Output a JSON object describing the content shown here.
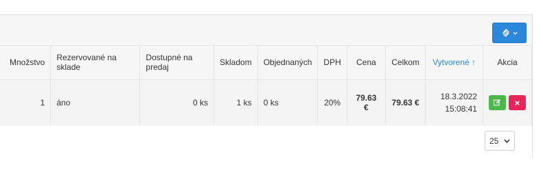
{
  "colors": {
    "accent": "#2b87da",
    "edit": "#4cb74a",
    "delete": "#e8255a"
  },
  "toolbar": {
    "settings_icon": "gear-icon",
    "settings_caret": "chevron-down-icon"
  },
  "table": {
    "columns": [
      {
        "key": "qty",
        "label": "Množstvo"
      },
      {
        "key": "reserved",
        "label": "Rezervované na sklade"
      },
      {
        "key": "available",
        "label": "Dostupné na predaj"
      },
      {
        "key": "stock",
        "label": "Skladom"
      },
      {
        "key": "ordered",
        "label": "Objednaných"
      },
      {
        "key": "vat",
        "label": "DPH"
      },
      {
        "key": "price",
        "label": "Cena"
      },
      {
        "key": "total",
        "label": "Celkom"
      },
      {
        "key": "created",
        "label": "Vytvorené ↑"
      },
      {
        "key": "actions",
        "label": "Akcia"
      }
    ],
    "rows": [
      {
        "qty": "1",
        "reserved": "áno",
        "available": "0 ks",
        "stock": "1 ks",
        "ordered": "0 ks",
        "vat": "20%",
        "price": "79.63 €",
        "total": "79.63 €",
        "created_date": "18.3.2022",
        "created_time": "15:08:41"
      }
    ]
  },
  "pager": {
    "page_size": "25"
  }
}
